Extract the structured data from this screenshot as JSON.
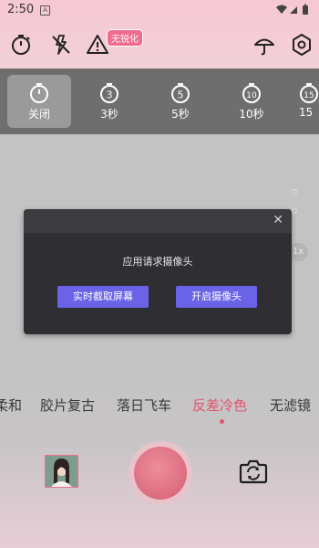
{
  "status_bar": {
    "time": "2:50",
    "notification_icon": "A"
  },
  "toolbar": {
    "icons": [
      "timer-icon",
      "flash-off-icon",
      "warning-icon",
      "umbrella-icon",
      "settings-hex-icon"
    ],
    "badge": "无锐化"
  },
  "timer": {
    "options": [
      {
        "label": "关闭",
        "icon_text": "",
        "selected": true
      },
      {
        "label": "3秒",
        "icon_text": "3",
        "selected": false
      },
      {
        "label": "5秒",
        "icon_text": "5",
        "selected": false
      },
      {
        "label": "10秒",
        "icon_text": "10",
        "selected": false
      },
      {
        "label": "15",
        "icon_text": "15",
        "selected": false
      }
    ]
  },
  "preview": {
    "zoom": "1x"
  },
  "dialog": {
    "message": "应用请求摄像头",
    "button_left": "实时截取屏幕",
    "button_right": "开启摄像头",
    "close": "✕"
  },
  "filters": {
    "items": [
      "柔和",
      "胶片复古",
      "落日飞车",
      "反差冷色",
      "无滤镜"
    ],
    "active": "反差冷色"
  },
  "colors": {
    "accent_pink": "#e3546f",
    "dialog_button": "#6a63e8",
    "dialog_bg": "#2e2e33"
  }
}
